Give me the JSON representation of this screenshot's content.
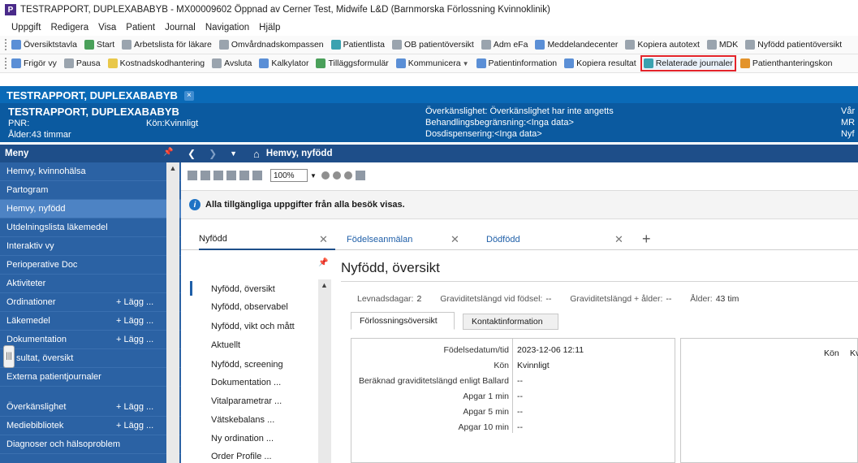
{
  "window": {
    "title": "TESTRAPPORT, DUPLEXABABYB - MX00009602 Öppnad av Cerner Test, Midwife L&D (Barnmorska Förlossning Kvinnoklinik)",
    "logo": "P"
  },
  "menubar": [
    "Uppgift",
    "Redigera",
    "Visa",
    "Patient",
    "Journal",
    "Navigation",
    "Hjälp"
  ],
  "toolbar1": [
    {
      "label": "Översiktstavla",
      "icon": "board-icon"
    },
    {
      "label": "Start",
      "icon": "home-icon"
    },
    {
      "label": "Arbetslista för läkare",
      "icon": "worklist-icon"
    },
    {
      "label": "Omvårdnadskompassen",
      "icon": "compass-icon"
    },
    {
      "label": "Patientlista",
      "icon": "patient-list-icon"
    },
    {
      "label": "OB patientöversikt",
      "icon": "ob-overview-icon"
    },
    {
      "label": "Adm eFa",
      "icon": "admin-icon"
    },
    {
      "label": "Meddelandecenter",
      "icon": "message-center-icon"
    },
    {
      "label": "Kopiera autotext",
      "icon": "copy-autotext-icon"
    },
    {
      "label": "MDK",
      "icon": "mdk-icon"
    },
    {
      "label": "Nyfödd patientöversikt",
      "icon": "newborn-overview-icon"
    }
  ],
  "toolbar2": [
    {
      "label": "Frigör vy",
      "icon": "release-view-icon"
    },
    {
      "label": "Pausa",
      "icon": "pause-icon"
    },
    {
      "label": "Kostnadskodhantering",
      "icon": "cost-code-icon"
    },
    {
      "label": "Avsluta",
      "icon": "exit-icon"
    },
    {
      "label": "Kalkylator",
      "icon": "calculator-icon"
    },
    {
      "label": "Tilläggsformulär",
      "icon": "addon-form-icon"
    },
    {
      "label": "Kommunicera",
      "icon": "communicate-icon"
    },
    {
      "label": "Patientinformation",
      "icon": "patient-info-icon"
    },
    {
      "label": "Kopiera resultat",
      "icon": "copy-result-icon"
    },
    {
      "label": "Relaterade journaler",
      "icon": "related-records-icon"
    },
    {
      "label": "Patienthanteringskon",
      "icon": "patient-handling-icon"
    }
  ],
  "patient_tab": {
    "label": "TESTRAPPORT, DUPLEXABABYB",
    "close": "×"
  },
  "banner": {
    "name": "TESTRAPPORT, DUPLEXABABYB",
    "pnr": "PNR:",
    "gender": "Kön:Kvinnligt",
    "age": "Ålder:43 timmar",
    "allergy": "Överkänslighet: Överkänslighet har inte angetts",
    "treatment": "Behandlingsbegränsning:<Inga data>",
    "dose": "Dosdispensering:<Inga data>",
    "right1": "Vår",
    "right2": "MR",
    "right3": "Nyf"
  },
  "leftnav": {
    "header": "Meny",
    "items": [
      {
        "label": "Hemvy, kvinnohälsa",
        "add": ""
      },
      {
        "label": "Partogram",
        "add": ""
      },
      {
        "label": "Hemvy, nyfödd",
        "add": ""
      },
      {
        "label": "Utdelningslista läkemedel",
        "add": ""
      },
      {
        "label": "Interaktiv vy",
        "add": ""
      },
      {
        "label": "Perioperative Doc",
        "add": ""
      },
      {
        "label": "Aktiviteter",
        "add": ""
      },
      {
        "label": "Ordinationer",
        "add": "+ Lägg ..."
      },
      {
        "label": "Läkemedel",
        "add": "+ Lägg ..."
      },
      {
        "label": "Dokumentation",
        "add": "+ Lägg ..."
      },
      {
        "label": "sultat, översikt",
        "add": ""
      },
      {
        "label": "Externa patientjournaler",
        "add": ""
      }
    ],
    "items_lower": [
      {
        "label": "Överkänslighet",
        "add": "+ Lägg ..."
      },
      {
        "label": "Mediebibliotek",
        "add": "+ Lägg ..."
      },
      {
        "label": "Diagnoser och hälsoproblem",
        "add": ""
      }
    ],
    "active_index": 2
  },
  "content": {
    "breadcrumb_title": "Hemvy, nyfödd",
    "zoom": "100%",
    "info_message": "Alla tillgängliga uppgifter från alla besök visas.",
    "doc_tabs": [
      "Nyfödd",
      "Födelseanmälan",
      "Dödfödd"
    ]
  },
  "subnav": [
    "Nyfödd, översikt",
    "Nyfödd, observabel",
    "Nyfödd, vikt och mått",
    "Aktuellt",
    "Nyfödd, screening",
    "Dokumentation ...",
    "Vitalparametrar ...",
    "Vätskebalans ...",
    "Ny ordination ...",
    "Order Profile ..."
  ],
  "main": {
    "title": "Nyfödd, översikt",
    "stats": [
      {
        "label": "Levnadsdagar:",
        "value": "2"
      },
      {
        "label": "Graviditetslängd vid födsel:",
        "value": "--"
      },
      {
        "label": "Graviditetslängd + ålder:",
        "value": "--"
      },
      {
        "label": "Ålder:",
        "value": "43 tim"
      }
    ],
    "subtabs": [
      "Förlossningsöversikt",
      "Kontaktinformation"
    ],
    "rows": [
      {
        "k": "Födelsedatum/tid",
        "v": "2023-12-06 12:11"
      },
      {
        "k": "Kön",
        "v": "Kvinnligt"
      },
      {
        "k": "Beräknad graviditetslängd enligt Ballard",
        "v": "--"
      },
      {
        "k": "Apgar 1 min",
        "v": "--"
      },
      {
        "k": "Apgar 5 min",
        "v": "--"
      },
      {
        "k": "Apgar 10 min",
        "v": "--"
      }
    ],
    "right_panel": {
      "k": "Kön",
      "v": "Kv"
    }
  },
  "colors": {
    "accent": "#0a6ab7",
    "banner": "#0b5aa0",
    "nav": "#2b62a4",
    "highlight": "#e3242b"
  }
}
